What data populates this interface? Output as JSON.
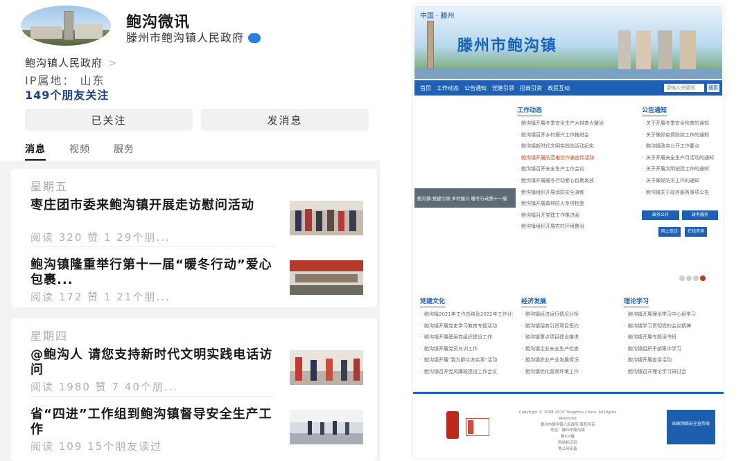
{
  "account": {
    "name": "鲍沟微讯",
    "org": "滕州市鲍沟镇人民政府",
    "owner": "鲍沟镇人民政府",
    "owner_chevron": ">",
    "ip_label": "IP属地：",
    "ip_value": "山东",
    "followers": "149个朋友关注",
    "followed_button": "已关注",
    "message_button": "发消息"
  },
  "tabs": [
    "消息",
    "视频",
    "服务"
  ],
  "feed": [
    {
      "day": "星期五",
      "posts": [
        {
          "title": "枣庄团市委来鲍沟镇开展走访慰问活动",
          "meta": "阅读 320  赞 1  29个朋..."
        },
        {
          "title": "鲍沟镇隆重举行第十一届“暖冬行动”爱心包裹...",
          "meta": "阅读 172  赞 1  21个朋..."
        }
      ]
    },
    {
      "day": "星期四",
      "posts": [
        {
          "title": "@鲍沟人 请您支持新时代文明实践电话访问",
          "meta": "阅读 1980  赞 7  40个朋..."
        },
        {
          "title": "省“四进”工作组到鲍沟镇督导安全生产工作",
          "meta": "阅读 109  15个朋友读过"
        }
      ]
    }
  ],
  "site": {
    "crumb": "中国 · 滕州",
    "title": "滕州市鲍沟镇",
    "nav": [
      "首页",
      "工作动态",
      "公告通知",
      "党建引领",
      "招商引资",
      "政民互动"
    ],
    "search_placeholder": "请输入关键词",
    "search_button": "搜索",
    "col1_head": "工作动态",
    "col2_head": "公告通知",
    "news_left": [
      "鲍沟镇开展冬季安全生产大排查大整治",
      "鲍沟镇召开乡村振兴工作推进会",
      "鲍沟镇新时代文明实践站活动纪实",
      "鲍沟镇开展防范电信诈骗宣传活动",
      "鲍沟镇召开安全生产工作会议",
      "鲍沟镇开展暖冬行动爱心包裹发放",
      "鲍沟镇组织开展消防安全演练",
      "鲍沟镇开展森林防火专项检查",
      "鲍沟镇召开党建工作推进会",
      "鲍沟镇组织开展农村环境整治"
    ],
    "news_right": [
      "关于开展冬季安全检查的通知",
      "关于做好疫情防控工作的通知",
      "鲍沟镇政务公开工作要点",
      "关于开展安全生产月活动的通知",
      "关于开展文明创建工作的通知",
      "关于做好防汛工作的通知",
      "鲍沟镇关于政务服务事项公告"
    ],
    "slider_caption": "鲍沟镇·党建引领·乡村振兴 暖冬行动第十一届",
    "btn_a": "政务公开",
    "btn_b": "政务服务",
    "btn_c": "网上信访",
    "btn_d": "在线咨询",
    "col3_head": "党建文化",
    "col4_head": "经济发展",
    "col5_head": "理论学习",
    "bottom_list": [
      "鲍沟镇2021年工作总结及2022年工作计划",
      "鲍沟镇开展党史学习教育专题活动",
      "鲍沟镇开展基层党组织建设工作",
      "鲍沟镇开展党员冬训工作",
      "鲍沟镇开展“我为群众办实事”活动",
      "鲍沟镇召开党风廉政建设工作会议"
    ],
    "bottom_list2": [
      "鲍沟镇经济运行情况分析",
      "鲍沟镇招商引资项目签约",
      "鲍沟镇重点项目建设推进",
      "鲍沟镇企业安全生产检查",
      "鲍沟镇农业产业发展情况",
      "鲍沟镇优化营商环境工作"
    ],
    "bottom_list3": [
      "鲍沟镇开展理论学习中心组学习",
      "鲍沟镇学习贯彻党的会议精神",
      "鲍沟镇开展专题读书班",
      "鲍沟镇组织干部集中学习",
      "鲍沟镇开展宣讲活动",
      "鲍沟镇召开理论学习研讨会"
    ],
    "footer_lines": [
      "Copyright © 2008-2018 Tengzhou China. All Rights Reserved",
      "滕州市鲍沟镇人民政府 版权所有",
      "地址：滕州市鲍沟镇",
      "鲁ICP备",
      "网站标识码",
      "鲁公网安备"
    ],
    "footer_badge": "国家网络安全宣传周"
  }
}
